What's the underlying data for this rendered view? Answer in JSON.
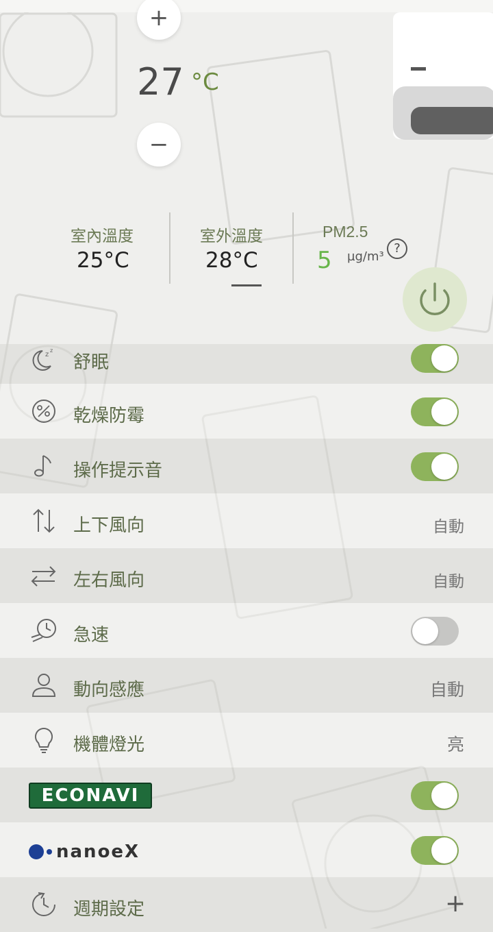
{
  "temperature": {
    "plus_symbol": "+",
    "value": "27",
    "unit": "°C",
    "minus_symbol": "−"
  },
  "stats": {
    "indoor": {
      "label": "室內溫度",
      "value": "25°C"
    },
    "outdoor": {
      "label": "室外溫度",
      "value": "28°C"
    },
    "pm25": {
      "label": "PM2.5",
      "value": "5",
      "unit": "µg/m³",
      "help": "?"
    }
  },
  "settings": {
    "sleep": {
      "label": "舒眠",
      "state": "on",
      "icon": "moon-sleep-icon"
    },
    "dry_mold": {
      "label": "乾燥防霉",
      "state": "on",
      "icon": "mold-icon"
    },
    "sound": {
      "label": "操作提示音",
      "state": "on",
      "icon": "music-note-icon"
    },
    "vertical_airflow": {
      "label": "上下風向",
      "value": "自動",
      "icon": "vertical-arrows-icon"
    },
    "horizontal_airflow": {
      "label": "左右風向",
      "value": "自動",
      "icon": "horizontal-arrows-icon"
    },
    "turbo": {
      "label": "急速",
      "state": "off",
      "icon": "fast-clock-icon"
    },
    "motion_sensor": {
      "label": "動向感應",
      "value": "自動",
      "icon": "person-icon"
    },
    "unit_light": {
      "label": "機體燈光",
      "value": "亮",
      "icon": "lightbulb-icon"
    },
    "econavi": {
      "label": "ECONAVI",
      "state": "on"
    },
    "nanoex": {
      "label": "nanoeX",
      "state": "on"
    },
    "schedule": {
      "label": "週期設定",
      "action": "+",
      "icon": "schedule-clock-icon"
    }
  },
  "colors": {
    "accent_green": "#8eb35c",
    "pm_green": "#67b54a",
    "label_green": "#5d6b4a",
    "background": "#efefed"
  }
}
